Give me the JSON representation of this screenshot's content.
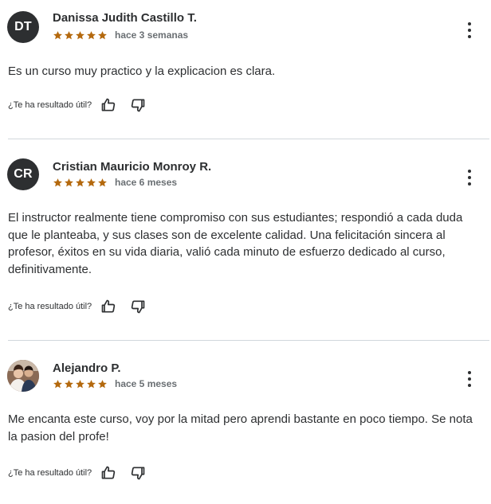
{
  "reviews": [
    {
      "initials": "DT",
      "name": "Danissa Judith Castillo T.",
      "rating": 5,
      "time": "hace 3 semanas",
      "content": "Es un curso muy practico y la explicacion es clara.",
      "helpful_label": "¿Te ha resultado útil?"
    },
    {
      "initials": "CR",
      "name": "Cristian Mauricio Monroy R.",
      "rating": 5,
      "time": "hace 6 meses",
      "content": "El instructor realmente tiene compromiso con sus estudiantes; respondió a cada duda que le planteaba, y sus clases son de excelente calidad. Una felicitación sincera al profesor, éxitos en su vida diaria, valió cada minuto de esfuerzo dedicado al curso, definitivamente.",
      "helpful_label": "¿Te ha resultado útil?"
    },
    {
      "initials": "",
      "name": "Alejandro P.",
      "rating": 5,
      "time": "hace 5 meses",
      "content": "Me encanta este curso, voy por la mitad pero aprendi bastante en poco tiempo. Se nota la pasion del profe!",
      "helpful_label": "¿Te ha resultado útil?"
    }
  ],
  "colors": {
    "star": "#b4690e",
    "avatar_bg": "#2d2f31",
    "text": "#2d2f31",
    "muted": "#6a6f73",
    "divider": "#d1d7dc"
  },
  "icons": {
    "rating": "star-icon",
    "more": "more-vertical-icon",
    "like": "thumbs-up-icon",
    "dislike": "thumbs-down-icon"
  }
}
